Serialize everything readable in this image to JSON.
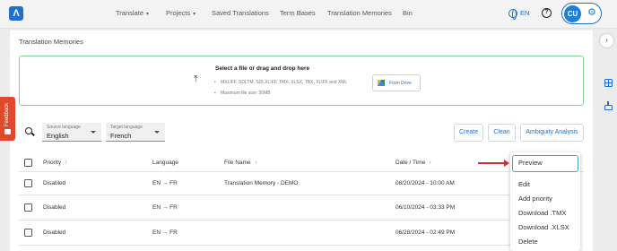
{
  "app": {
    "logo_glyph": "Λ",
    "nav": [
      {
        "label": "Translate",
        "has_menu": true
      },
      {
        "label": "Projects",
        "has_menu": true
      },
      {
        "label": "Saved Translations",
        "has_menu": false
      },
      {
        "label": "Term Bases",
        "has_menu": false
      },
      {
        "label": "Translation Memories",
        "has_menu": false
      },
      {
        "label": "Bin",
        "has_menu": false
      }
    ],
    "language_code": "EN",
    "help_glyph": "?",
    "avatar_initials": "CU",
    "accent_color": "#1e6fd0"
  },
  "page": {
    "title": "Translation Memories"
  },
  "upload": {
    "title": "Select a file or drag and drop here",
    "formats": "MXLIFF, SDLTM, SDLXLIFF, TMX, XLSX, TBX, XLIFF and XML",
    "max_size": "Maximum file size: 30MB",
    "drive_button": "From Drive"
  },
  "filters": {
    "source_label": "Source language",
    "source_value": "English",
    "target_label": "Target language",
    "target_value": "French"
  },
  "actions": {
    "create": "Create",
    "clean": "Clean",
    "ambiguity": "Ambiguity Analysis"
  },
  "table": {
    "headers": {
      "priority": "Priority",
      "language": "Language",
      "file_name": "File Name",
      "date_time": "Date / Time",
      "sort_glyph": "↑"
    },
    "rows": [
      {
        "priority": "Disabled",
        "language": "EN  →  FR",
        "file_name": "Translation Memory - DEMO",
        "date": "08/20/2024 - 10:00 AM"
      },
      {
        "priority": "Disabled",
        "language": "EN  →  FR",
        "file_name": "",
        "date": "06/10/2024 - 03:33 PM"
      },
      {
        "priority": "Disabled",
        "language": "EN  →  FR",
        "file_name": "",
        "date": "06/28/2024 - 02:49 PM"
      }
    ]
  },
  "context_menu": {
    "items": [
      "Preview",
      "Edit",
      "Add priority",
      "Download .TMX",
      "Download .XLSX",
      "Delete"
    ],
    "highlighted": "Preview",
    "highlight_color": "#3aa8c9",
    "arrow_color": "#d32f2f"
  },
  "feedback": {
    "label": "Feedback",
    "color": "#e04a2a"
  },
  "right_rail": {
    "toggle_glyph": "›"
  }
}
